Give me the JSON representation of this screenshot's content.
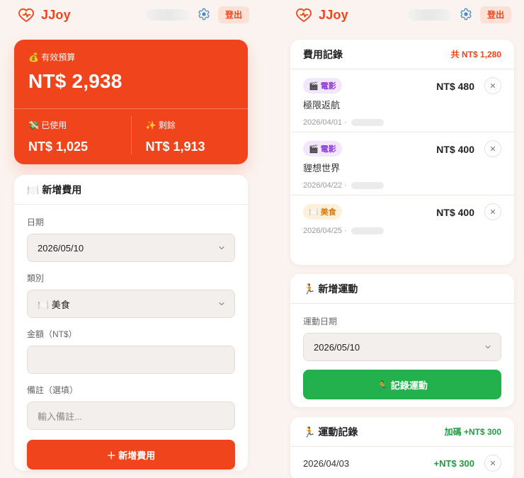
{
  "brand": {
    "name": "JJoy",
    "accent": "#F0441C"
  },
  "topbar": {
    "logout_label": "登出",
    "icons": {
      "brand": "heart-pulse-icon",
      "settings": "gear-icon"
    }
  },
  "left": {
    "budget": {
      "label": "💰 有效預算",
      "amount": "NT$ 2,938",
      "used_label": "💸 已使用",
      "used_amount": "NT$ 1,025",
      "remaining_label": "✨ 剩餘",
      "remaining_amount": "NT$ 1,913"
    },
    "add_expense": {
      "title": "🍽️ 新增費用",
      "date_label": "日期",
      "date_value": "2026/05/10",
      "category_label": "類別",
      "category_value": "🍽️ 美食",
      "amount_label": "金額（NT$）",
      "amount_value": "",
      "note_label": "備註（選填）",
      "note_placeholder": "輸入備註...",
      "submit_label": "＋ 新增費用"
    }
  },
  "right": {
    "expense_records": {
      "title": "費用記錄",
      "total_label": "共 NT$ 1,280",
      "items": [
        {
          "tag": "🎬 電影",
          "tag_type": "movie",
          "amount": "NT$ 480",
          "title": "極限返航",
          "meta": "2026/04/01 ·"
        },
        {
          "tag": "🎬 電影",
          "tag_type": "movie",
          "amount": "NT$ 400",
          "title": "貍想世界",
          "meta": "2026/04/22 ·"
        },
        {
          "tag": "🍽️ 美食",
          "tag_type": "food",
          "amount": "NT$ 400",
          "title": "",
          "meta": "2026/04/25 ·"
        }
      ]
    },
    "add_exercise": {
      "title": "🏃 新增運動",
      "date_label": "運動日期",
      "date_value": "2026/05/10",
      "submit_label": "🏃 記錄運動",
      "button_color": "#22B14C"
    },
    "exercise_records": {
      "title": "🏃 運動記錄",
      "bonus_label": "加碼 +NT$ 300",
      "items": [
        {
          "date": "2026/04/03",
          "amount": "+NT$ 300"
        }
      ]
    }
  }
}
